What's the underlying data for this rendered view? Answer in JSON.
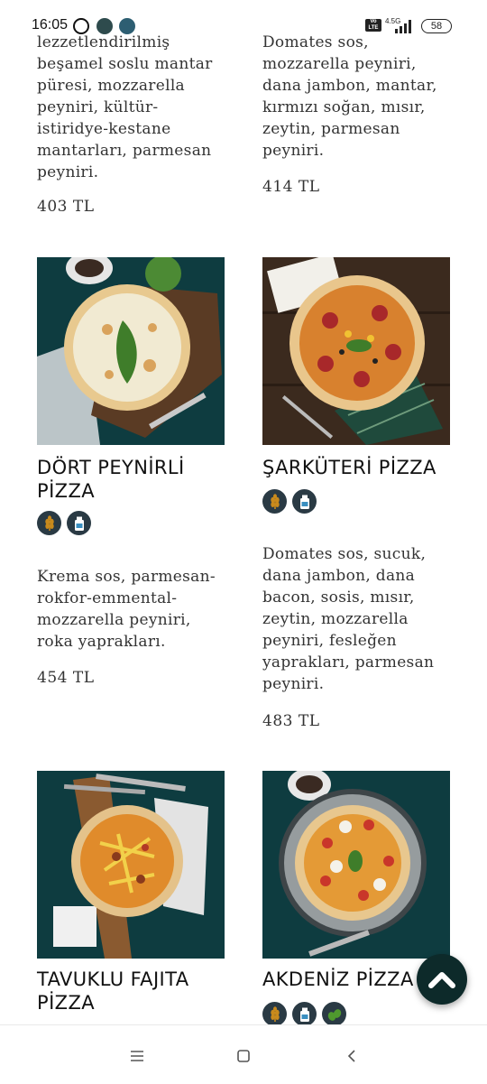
{
  "status_bar": {
    "time": "16:05",
    "network": "4.5G",
    "volte": "Vo LTE",
    "battery": "58"
  },
  "menu_items": [
    {
      "name": "",
      "description": "lezzetlendirilmiş\nbeşamel soslu mantar\npüresi, mozzarella\npeyniri, kültür-\nistiridye-kestane\nmantarları, parmesan\npeyniri.",
      "price": "403 TL",
      "badges": []
    },
    {
      "name": "",
      "description": "Domates sos,\nmozzarella peyniri,\ndana jambon, mantar,\nkırmızı soğan, mısır,\nzeytin, parmesan\npeyniri.",
      "price": "414 TL",
      "badges": []
    },
    {
      "name": "DÖRT PEYNİRLİ\nPİZZA",
      "description": "Krema sos, parmesan-\nrokfor-emmental-\nmozzarella peyniri,\nroka yaprakları.",
      "price": "454 TL",
      "badges": [
        "wheat-icon",
        "milk-icon"
      ]
    },
    {
      "name": "ŞARKÜTERİ PİZZA",
      "description": "Domates sos, sucuk,\ndana jambon, dana\nbacon, sosis, mısır,\nzeytin, mozzarella\npeyniri, fesleğen\nyaprakları, parmesan\npeyniri.",
      "price": "483 TL",
      "badges": [
        "wheat-icon",
        "milk-icon"
      ]
    },
    {
      "name": "TAVUKLU FAJITA\nPİZZA",
      "description": "",
      "price": "",
      "badges": []
    },
    {
      "name": "AKDENİZ PİZZA",
      "description": "",
      "price": "",
      "badges": [
        "wheat-icon",
        "milk-icon",
        "olive-icon"
      ]
    }
  ],
  "colors": {
    "photo_teal": "#0e3c40",
    "photo_wood": "#3b2a1e",
    "badge_bg": "#2a3a44",
    "badge_wheat": "#c98a1c",
    "badge_milk": "#3a8fc0",
    "badge_olive": "#4f9a2e",
    "fab_bg": "#0d2a2a"
  },
  "navigation": {
    "menu": "menu-icon",
    "home": "home-icon",
    "back": "back-icon"
  }
}
